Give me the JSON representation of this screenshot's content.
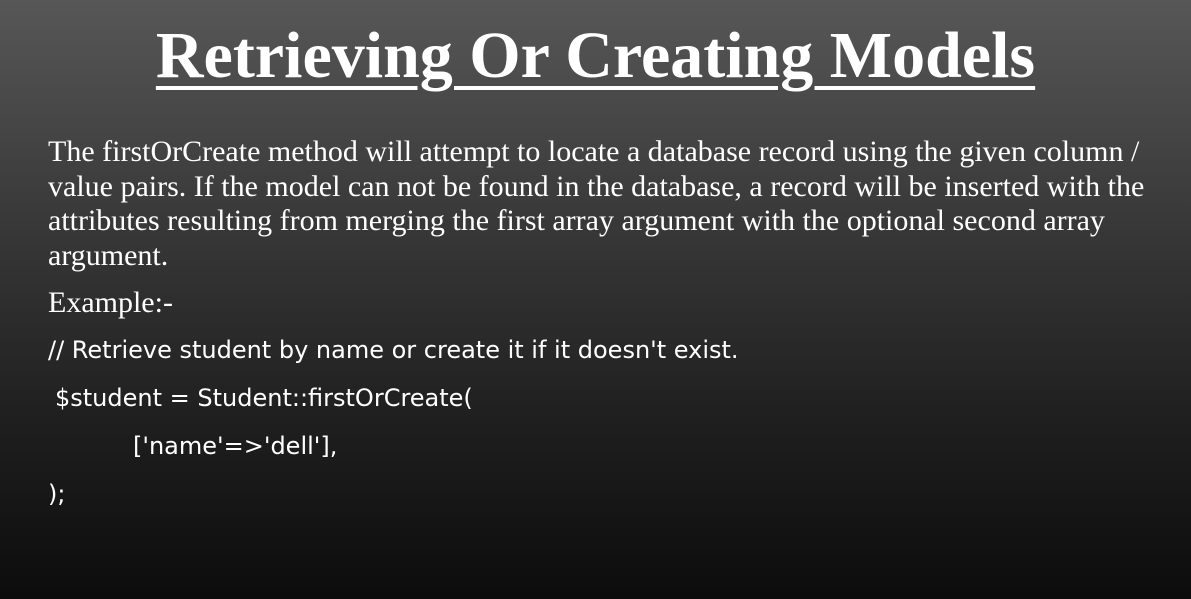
{
  "slide": {
    "title": "Retrieving Or Creating Models",
    "description": "The firstOrCreate method will attempt to locate a database record using the given column / value pairs. If the model can not be found in the database, a record will be inserted with the attributes resulting from merging the first array argument with the optional second array argument.",
    "example_label": "Example:-",
    "code_lines": [
      "// Retrieve student by name or create it if it doesn't exist.",
      "$student = Student::firstOrCreate(",
      "['name'=>'dell'],",
      ");"
    ]
  }
}
